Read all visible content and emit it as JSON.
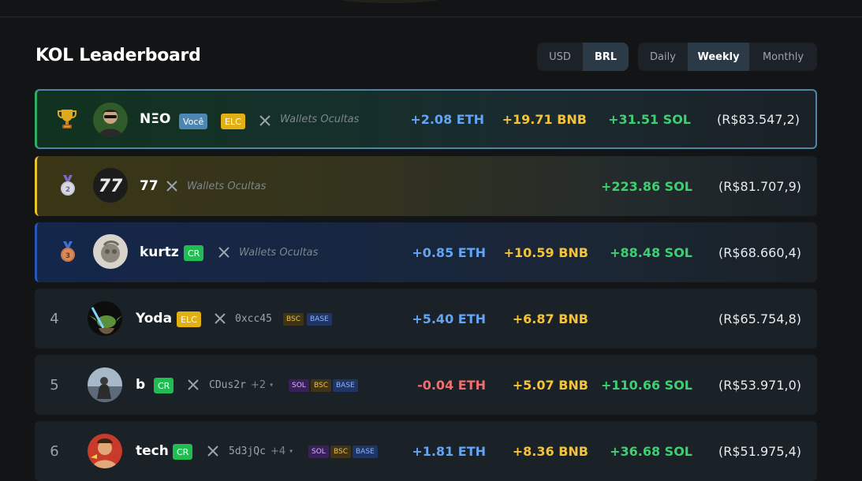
{
  "header": {
    "title": "KOL Leaderboard"
  },
  "currency": {
    "options": [
      "USD",
      "BRL"
    ],
    "selected": "BRL"
  },
  "period": {
    "options": [
      "Daily",
      "Weekly",
      "Monthly"
    ],
    "selected": "Weekly"
  },
  "rows": [
    {
      "rank": "1",
      "rank_icon": "trophy-icon",
      "name": "NΞO",
      "badges": [
        "Você",
        "ELC"
      ],
      "wallets": "Wallets Ocultas",
      "eth": "+2.08 ETH",
      "bnb": "+19.71 BNB",
      "sol": "+31.51 SOL",
      "total": "(R$83.547,2)"
    },
    {
      "rank": "2",
      "rank_icon": "silver-medal-icon",
      "name": "77",
      "badges": [],
      "wallets": "Wallets Ocultas",
      "eth": "",
      "bnb": "",
      "sol": "+223.86 SOL",
      "total": "(R$81.707,9)"
    },
    {
      "rank": "3",
      "rank_icon": "bronze-medal-icon",
      "name": "kurtz",
      "badges": [
        "CR"
      ],
      "wallets": "Wallets Ocultas",
      "eth": "+0.85 ETH",
      "bnb": "+10.59 BNB",
      "sol": "+88.48 SOL",
      "total": "(R$68.660,4)"
    },
    {
      "rank": "4",
      "name": "Yoda",
      "badges": [
        "ELC"
      ],
      "address": "0xcc45",
      "more": "",
      "chains": [
        "BSC",
        "BASE"
      ],
      "eth": "+5.40 ETH",
      "bnb": "+6.87 BNB",
      "sol": "",
      "total": "(R$65.754,8)"
    },
    {
      "rank": "5",
      "name": "b",
      "badges": [
        "CR"
      ],
      "address": "CDus2r",
      "more": "+2",
      "chains": [
        "SOL",
        "BSC",
        "BASE"
      ],
      "eth": "-0.04 ETH",
      "bnb": "+5.07 BNB",
      "sol": "+110.66 SOL",
      "total": "(R$53.971,0)"
    },
    {
      "rank": "6",
      "name": "tech",
      "badges": [
        "CR"
      ],
      "address": "5d3jQc",
      "more": "+4",
      "chains": [
        "SOL",
        "BSC",
        "BASE"
      ],
      "eth": "+1.81 ETH",
      "bnb": "+8.36 BNB",
      "sol": "+36.68 SOL",
      "total": "(R$51.975,4)"
    }
  ],
  "colors": {
    "background": "#121416",
    "eth": "#63a4f5",
    "eth_negative": "#f06e6e",
    "bnb": "#f3c33b",
    "sol": "#3ecf73",
    "accent_selected": "#4e86a8"
  }
}
